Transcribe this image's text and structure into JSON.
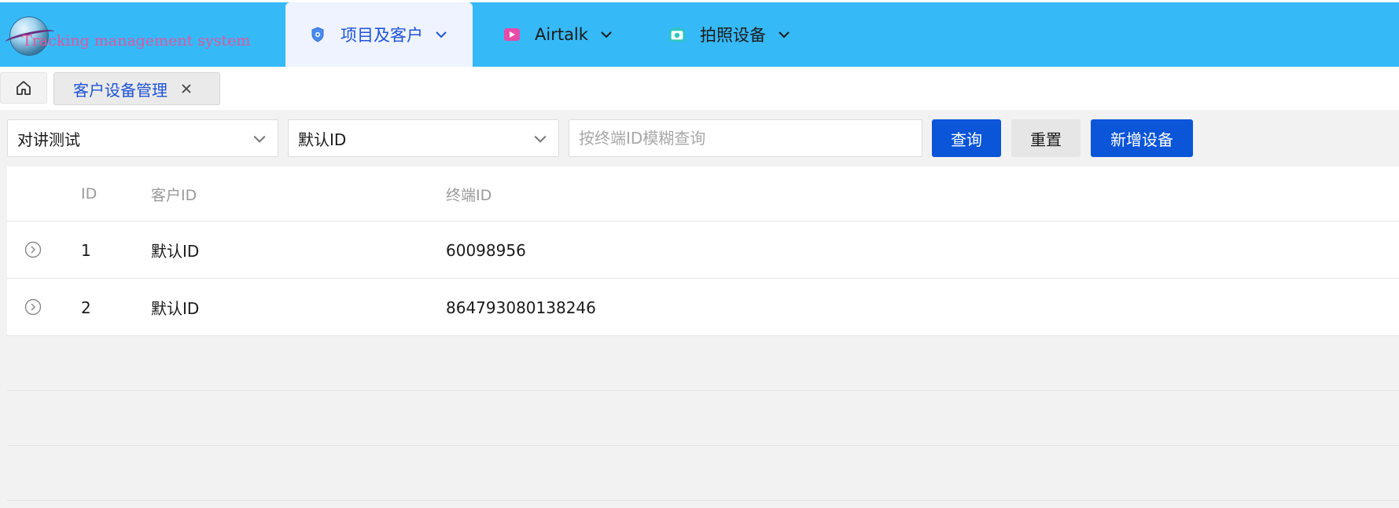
{
  "app": {
    "logo_text": "Tracking management system"
  },
  "nav": {
    "items": [
      {
        "label": "项目及客户",
        "icon": "shield-icon",
        "active": true
      },
      {
        "label": "Airtalk",
        "icon": "video-icon",
        "active": false
      },
      {
        "label": "拍照设备",
        "icon": "camera-icon",
        "active": false
      }
    ]
  },
  "tabs": {
    "home_icon": "home-icon",
    "current": {
      "label": "客户设备管理",
      "close_icon": "close-icon"
    }
  },
  "filters": {
    "project_select": {
      "value": "对讲测试"
    },
    "customer_select": {
      "value": "默认ID"
    },
    "terminal_search": {
      "value": "",
      "placeholder": "按终端ID模糊查询"
    },
    "query_label": "查询",
    "reset_label": "重置",
    "add_label": "新增设备"
  },
  "table": {
    "columns": [
      "ID",
      "客户ID",
      "终端ID"
    ],
    "rows": [
      {
        "id": "1",
        "customer_id": "默认ID",
        "terminal_id": "60098956"
      },
      {
        "id": "2",
        "customer_id": "默认ID",
        "terminal_id": "864793080138246"
      }
    ]
  },
  "colors": {
    "topbar": "#36b9f7",
    "primary": "#0b55d9",
    "active_nav_text": "#1f53d6"
  }
}
